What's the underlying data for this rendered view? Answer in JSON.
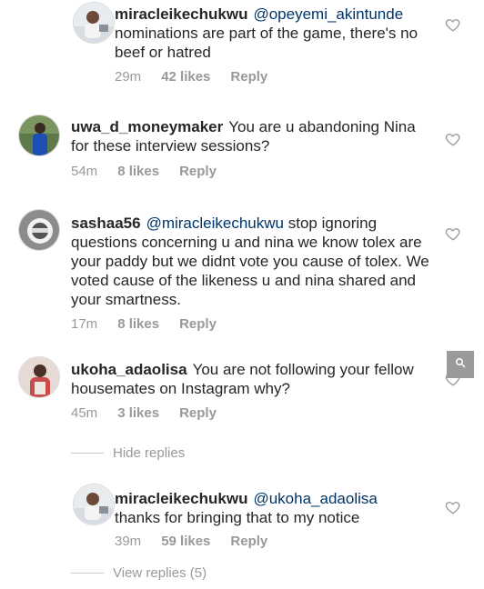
{
  "comments": [
    {
      "username": "miracleikechukwu",
      "mention": "@opeyemi_akintunde",
      "text": "nominations are part of the game, there's no beef or hatred",
      "time": "29m",
      "likes": "42 likes",
      "reply": "Reply"
    },
    {
      "username": "uwa_d_moneymaker",
      "mention": "",
      "text": "You are u abandoning Nina for these interview sessions?",
      "time": "54m",
      "likes": "8 likes",
      "reply": "Reply"
    },
    {
      "username": "sashaa56",
      "mention": "@miracleikechukwu",
      "text": "stop ignoring questions concerning u and nina we know tolex are your paddy but we didnt vote you cause of tolex. We voted cause of the likeness  u and nina shared and your smartness.",
      "time": "17m",
      "likes": "8 likes",
      "reply": "Reply"
    },
    {
      "username": "ukoha_adaolisa",
      "mention": "",
      "text": "You are not following your fellow housemates on Instagram why?",
      "time": "45m",
      "likes": "3 likes",
      "reply": "Reply"
    },
    {
      "username": "miracleikechukwu",
      "mention": "@ukoha_adaolisa",
      "text": "thanks for bringing that to my notice",
      "time": "39m",
      "likes": "59 likes",
      "reply": "Reply"
    }
  ],
  "hide_replies": "Hide replies",
  "view_replies": "View replies (5)",
  "icons": {
    "heart": "heart-outline-icon",
    "search": "search-icon"
  },
  "colors": {
    "mention": "#003569",
    "meta": "#999999",
    "search_bg": "#9a9a9a"
  }
}
